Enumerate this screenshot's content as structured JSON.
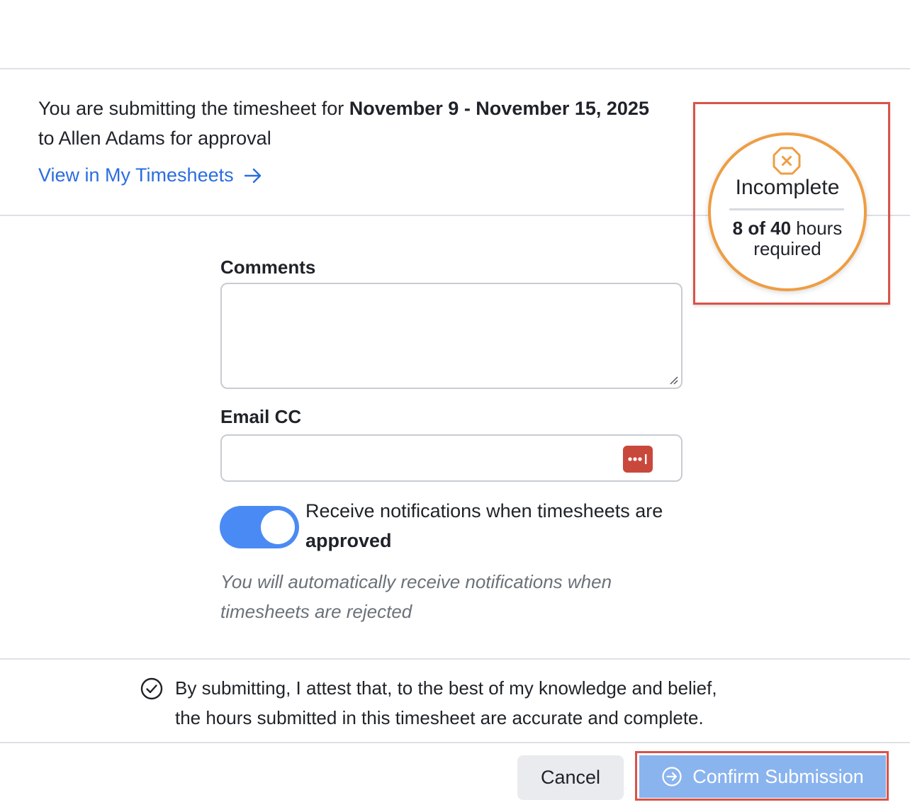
{
  "intro": {
    "prefix": "You are submitting the timesheet for ",
    "date_range": "November 9 - November 15, 2025",
    "suffix": "to Allen Adams for approval"
  },
  "view_link": {
    "label": "View in My Timesheets",
    "icon": "arrow-right-icon"
  },
  "status_badge": {
    "icon": "octagon-x-icon",
    "title": "Incomplete",
    "hours_logged_text": "8 of 40",
    "hours_suffix": " hours",
    "required_text": "required",
    "hours_logged": 8,
    "hours_required": 40,
    "accent_color": "#ee9d43"
  },
  "comments": {
    "label": "Comments",
    "value": ""
  },
  "email_cc": {
    "label": "Email CC",
    "value": "",
    "autofill_icon": "password-manager-icon"
  },
  "notifications_toggle": {
    "on": true,
    "label_text": "Receive notifications when timesheets are",
    "label_bold": "approved",
    "color": "#4a8af4"
  },
  "auto_note": "You will automatically receive notifications when timesheets are rejected",
  "attestation": {
    "icon": "check-circle-icon",
    "line1": "By submitting, I attest that, to the best of my knowledge and belief,",
    "line2": "the hours submitted in this timesheet are accurate and complete."
  },
  "buttons": {
    "cancel": "Cancel",
    "confirm": "Confirm Submission",
    "confirm_icon": "arrow-circle-right-icon"
  },
  "colors": {
    "link": "#2b6de0",
    "highlight": "#d9534a",
    "confirm_bg": "#8ab4ee"
  }
}
